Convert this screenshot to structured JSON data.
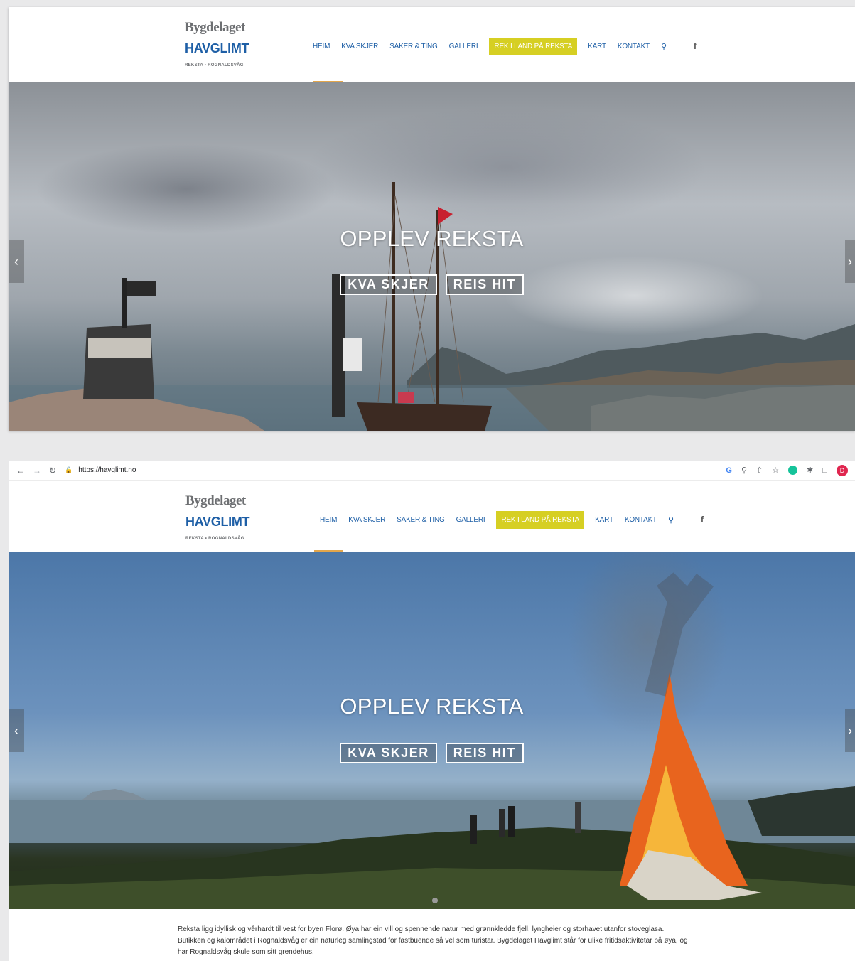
{
  "browser": {
    "url": "https://havglimt.no",
    "profile_initial": "D"
  },
  "site": {
    "logo_top": "Bygdelaget",
    "logo_main": "HAVGLIMT",
    "logo_sub": "REKSTA • ROGNALDSVÅG"
  },
  "nav": {
    "items": [
      "HEIM",
      "KVA SKJER",
      "SAKER & TING",
      "GALLERI",
      "REK I LAND PÅ REKSTA",
      "KART",
      "KONTAKT"
    ],
    "active": "HEIM",
    "highlighted": "REK I LAND PÅ REKSTA"
  },
  "hero": {
    "title": "OPPLEV REKSTA",
    "button_1": "KVA SKJER",
    "button_2": "REIS HIT"
  },
  "intro_text": "Reksta ligg idyllisk og vêrhardt til vest for byen Florø. Øya har ein vill og spennende natur med grønnkledde fjell, lyngheier og storhavet utanfor stoveglasa. Butikken og kaiområdet i Rognaldsvåg er ein naturleg samlingstad for fastbuende så vel som turistar. Bygdelaget Havglimt står for ulike fritidsaktivitetar på øya, og har Rognaldsvåg skule som sitt grendehus.",
  "icons": {
    "search": "search-icon",
    "facebook": "facebook-icon",
    "prev": "chevron-left-icon",
    "next": "chevron-right-icon"
  },
  "colors": {
    "brand_blue": "#1e5fa6",
    "highlight_yellow": "#d6cf23",
    "active_orange": "#e3a64b"
  }
}
